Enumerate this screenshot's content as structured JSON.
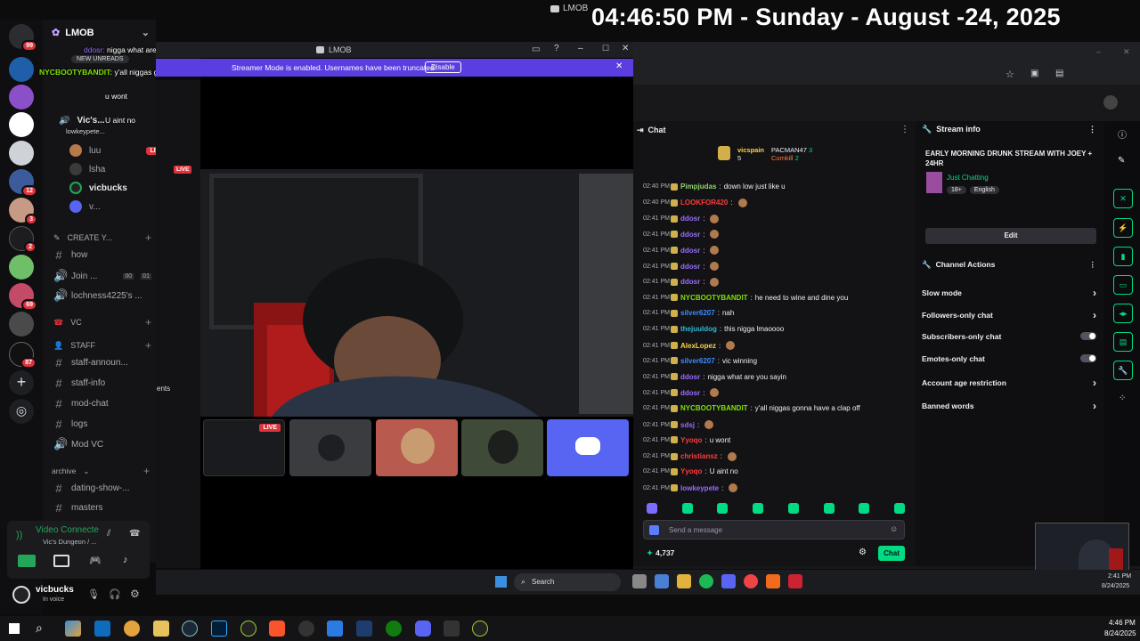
{
  "overlay": {
    "clock": "04:46:50 PM - Sunday - August -24, 2025",
    "mini_title": "LMOB"
  },
  "server_badges": [
    "99",
    "12",
    "3",
    "2",
    "69",
    "87"
  ],
  "channel_panel": {
    "server_name": "LMOB",
    "new_unreads": "NEW UNREADS",
    "voice_users": [
      {
        "name": "luu",
        "live": "LIVE"
      },
      {
        "name": "lsha",
        "live": ""
      },
      {
        "name": "vicbucks",
        "live": ""
      },
      {
        "name": "v...",
        "live": ""
      }
    ],
    "status_users": [
      "Vic's...",
      "lowkeypete..."
    ],
    "create_category": "CREATE Y...",
    "channels_top": [
      {
        "name": "how"
      },
      {
        "name": "Join ...",
        "a": "00",
        "b": "01"
      },
      {
        "name": "lochness4225's ..."
      }
    ],
    "vc_category": "VC",
    "staff_category": "STAFF",
    "staff_channels": [
      "staff-announ...",
      "staff-info",
      "mod-chat",
      "logs",
      "Mod VC"
    ],
    "archive_category": "archive",
    "archive_channels": [
      "dating-show-...",
      "masters"
    ],
    "voice_connected": "Video Connecte",
    "voice_server": "Vic's Dungeon / ...",
    "user_name": "vicbucks",
    "user_status": "In voice"
  },
  "stream_window": {
    "title": "LMOB",
    "banner": "Streamer Mode is enabled. Usernames have been truncated.",
    "disable": "Disable",
    "tile_live": "LIVE",
    "side_label": "ents"
  },
  "left_overlay_chat": [
    {
      "user": "ddosr:",
      "msg": "nigga what are you sayin"
    },
    {
      "user": "NYCBOOTYBANDIT:",
      "msg": "y'all niggas gonna have a clap off"
    },
    {
      "user": "",
      "msg": "u wont"
    },
    {
      "user": "",
      "msg": "U aint no"
    }
  ],
  "chat": {
    "title": "Chat",
    "leaders": [
      {
        "name": "vicspain",
        "val": "5"
      },
      {
        "name": "PACMAN47",
        "val": "3"
      },
      {
        "name": "Cumkill",
        "val": "2"
      }
    ],
    "messages": [
      {
        "t": "02:40 PM",
        "u": "Pimpjudas",
        "c": "#8fd16b",
        "m": "down low just like u"
      },
      {
        "t": "02:40 PM",
        "u": "LOOKFOR420",
        "c": "#ff3a3a",
        "m": ""
      },
      {
        "t": "02:41 PM",
        "u": "ddosr",
        "c": "#9a6bff",
        "m": ""
      },
      {
        "t": "02:41 PM",
        "u": "ddosr",
        "c": "#9a6bff",
        "m": ""
      },
      {
        "t": "02:41 PM",
        "u": "ddosr",
        "c": "#9a6bff",
        "m": ""
      },
      {
        "t": "02:41 PM",
        "u": "ddosr",
        "c": "#9a6bff",
        "m": ""
      },
      {
        "t": "02:41 PM",
        "u": "ddosr",
        "c": "#9a6bff",
        "m": ""
      },
      {
        "t": "02:41 PM",
        "u": "NYCBOOTYBANDIT",
        "c": "#7ee000",
        "m": "he need to wine and dine you"
      },
      {
        "t": "02:41 PM",
        "u": "silver6207",
        "c": "#3b8bff",
        "m": "nah"
      },
      {
        "t": "02:41 PM",
        "u": "thejuuldog",
        "c": "#2fb9d3",
        "m": "this nigga lmaoooo"
      },
      {
        "t": "02:41 PM",
        "u": "AlexLopez",
        "c": "#ffd23f",
        "m": ""
      },
      {
        "t": "02:41 PM",
        "u": "silver6207",
        "c": "#3b8bff",
        "m": "vic winning"
      },
      {
        "t": "02:41 PM",
        "u": "ddosr",
        "c": "#9a6bff",
        "m": "nigga what are you sayin"
      },
      {
        "t": "02:41 PM",
        "u": "ddosr",
        "c": "#9a6bff",
        "m": ""
      },
      {
        "t": "02:41 PM",
        "u": "NYCBOOTYBANDIT",
        "c": "#7ee000",
        "m": "y'all niggas gonna have a clap off"
      },
      {
        "t": "02:41 PM",
        "u": "sdsj",
        "c": "#9a6bff",
        "m": ""
      },
      {
        "t": "02:41 PM",
        "u": "Yyoqo",
        "c": "#ff3a3a",
        "m": "u wont"
      },
      {
        "t": "02:41 PM",
        "u": "christiansz",
        "c": "#ff3a3a",
        "m": ""
      },
      {
        "t": "02:41 PM",
        "u": "Yyoqo",
        "c": "#ff3a3a",
        "m": "U aint no"
      },
      {
        "t": "02:41 PM",
        "u": "lowkeypete",
        "c": "#9a6bff",
        "m": ""
      }
    ],
    "input_placeholder": "Send a message",
    "points": "4,737",
    "send": "Chat"
  },
  "stream_info": {
    "title": "Stream info",
    "stream_title": "EARLY MORNING DRUNK STREAM WITH JOEY + 24HR",
    "category": "Just Chatting",
    "tags": [
      "18+",
      "English"
    ],
    "edit": "Edit"
  },
  "channel_actions": {
    "title": "Channel Actions",
    "items": [
      {
        "label": "Slow mode",
        "kind": "arrow"
      },
      {
        "label": "Followers-only chat",
        "kind": "arrow"
      },
      {
        "label": "Subscribers-only chat",
        "kind": "toggle"
      },
      {
        "label": "Emotes-only chat",
        "kind": "toggle"
      },
      {
        "label": "Account age restriction",
        "kind": "arrow"
      },
      {
        "label": "Banned words",
        "kind": "arrow"
      }
    ]
  },
  "inner_taskbar": {
    "search": "Search",
    "time": "2:41 PM",
    "date": "8/24/2025"
  },
  "taskbar": {
    "time": "4:46 PM",
    "date": "8/24/2025"
  },
  "colors": {
    "twitch_green": "#00db84",
    "discord_blurple": "#5865f2",
    "live_red": "#e0323b",
    "banner_purple": "#5b3de0"
  }
}
